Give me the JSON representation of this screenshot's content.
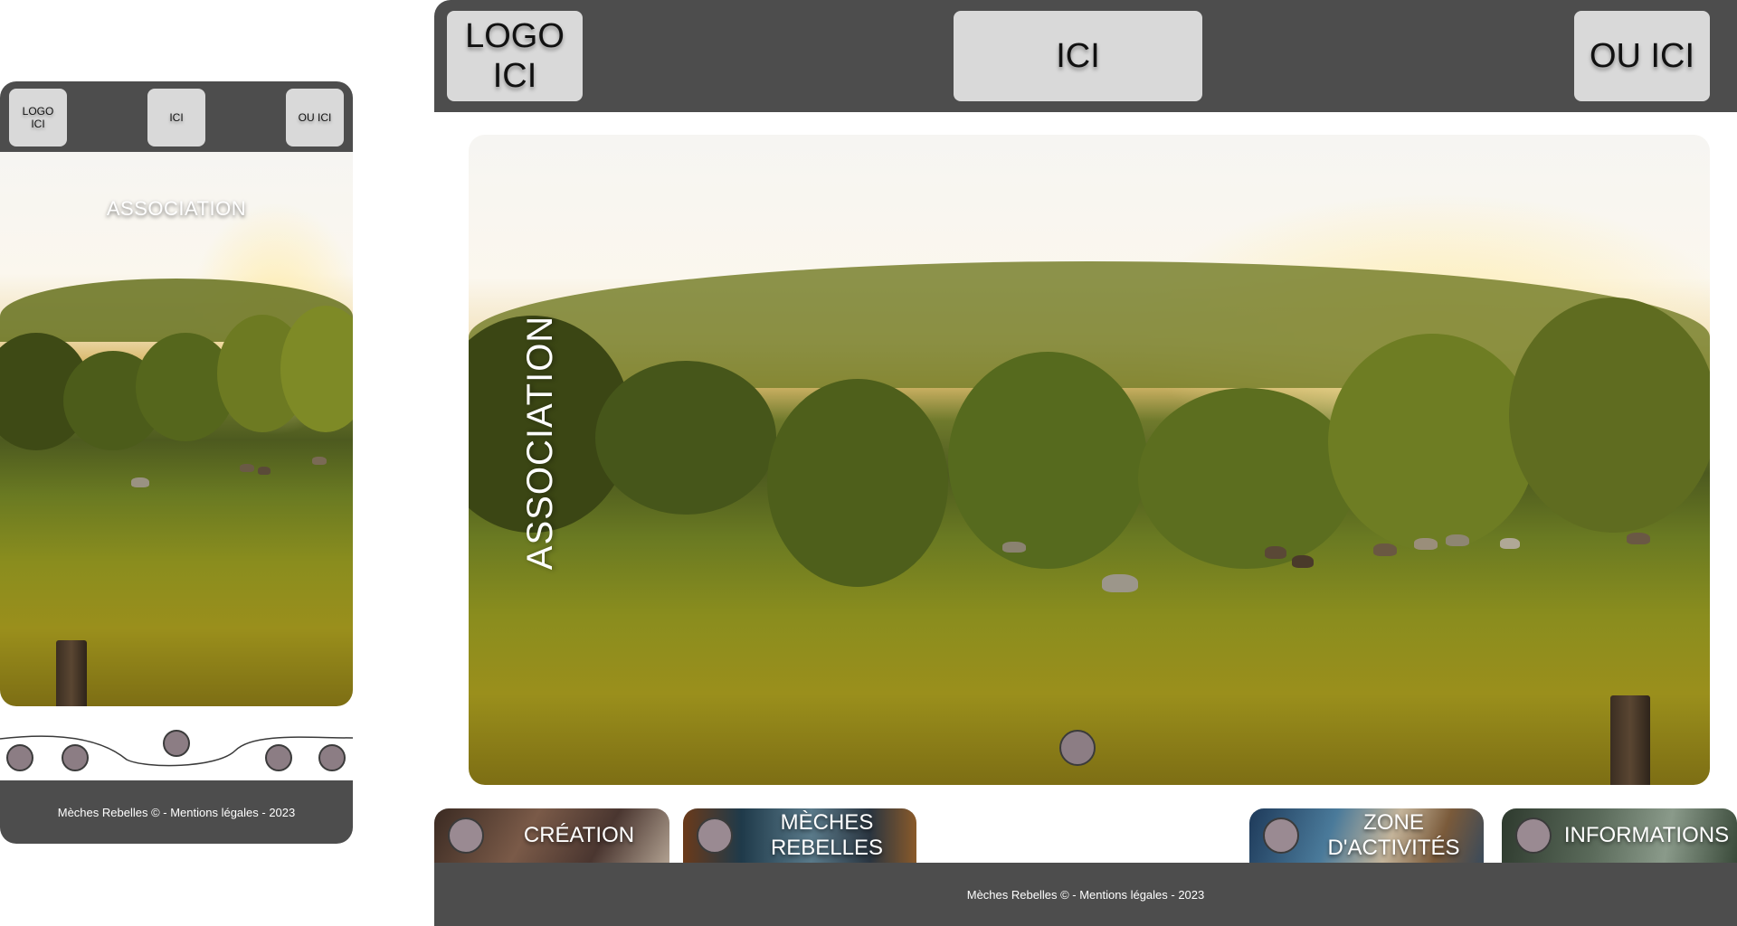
{
  "mobile": {
    "header": {
      "logo_label": "LOGO\nICI",
      "center_label": "ICI",
      "right_label": "OU ICI"
    },
    "hero": {
      "title": "ASSOCIATION"
    },
    "slider": {
      "dots_count": 5,
      "active_index": 2
    },
    "footer": {
      "text": "Mèches Rebelles © - Mentions légales - 2023"
    }
  },
  "desktop": {
    "header": {
      "logo_label": "LOGO\nICI",
      "center_label": "ICI",
      "right_label": "OU ICI"
    },
    "hero": {
      "title": "ASSOCIATION"
    },
    "cards": [
      {
        "label": "CRÉATION"
      },
      {
        "label": "MÈCHES\nREBELLES"
      },
      {
        "label": "ZONE\nD'ACTIVITÉS"
      },
      {
        "label": "INFORMATIONS"
      }
    ],
    "footer": {
      "text": "Mèches Rebelles © - Mentions légales - 2023"
    }
  },
  "colors": {
    "header_bg": "#4d4d4d",
    "button_bg": "#d9d9d9",
    "dot_fill": "#8c7d84"
  }
}
